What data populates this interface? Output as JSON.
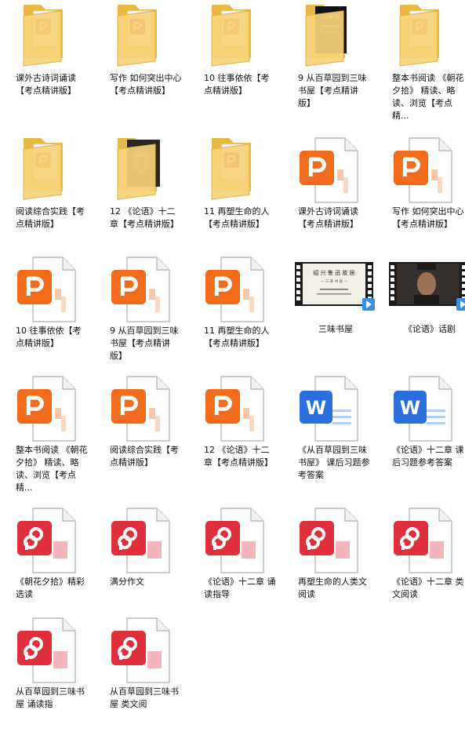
{
  "colors": {
    "folder_back": "#e8b943",
    "folder_front": "#f6d37a",
    "ppt_orange": "#f26a1b",
    "pdf_red": "#e02f3c",
    "word_blue": "#2a6fdb"
  },
  "items": [
    {
      "type": "folder",
      "thumb": "ppt",
      "label": "课外古诗词诵读【考点精讲版】"
    },
    {
      "type": "folder",
      "thumb": "ppt-red",
      "label": "写作 如何突出中心【考点精讲版】"
    },
    {
      "type": "folder",
      "thumb": "ppt",
      "label": "10 往事依依【考点精讲版】"
    },
    {
      "type": "folder",
      "thumb": "book",
      "label": "9 从百草园到三味书屋【考点精讲版】"
    },
    {
      "type": "folder",
      "thumb": "ppt",
      "label": "整本书阅读 《朝花夕拾》 精读、略读、浏览【考点精..."
    },
    {
      "type": "folder",
      "thumb": "ppt",
      "label": "阅读综合实践【考点精讲版】"
    },
    {
      "type": "folder",
      "thumb": "photo",
      "label": "12 《论语》十二章【考点精讲版】"
    },
    {
      "type": "folder",
      "thumb": "ppt-red",
      "label": "11 再塑生命的人【考点精讲版】"
    },
    {
      "type": "pptx",
      "label": "课外古诗词诵读【考点精讲版】"
    },
    {
      "type": "pptx",
      "label": "写作 如何突出中心【考点精讲版】"
    },
    {
      "type": "pptx",
      "label": "10 往事依依【考点精讲版】"
    },
    {
      "type": "pptx",
      "label": "9 从百草园到三味书屋【考点精讲版】"
    },
    {
      "type": "pptx",
      "label": "11 再塑生命的人【考点精讲版】"
    },
    {
      "type": "video",
      "thumb": "book",
      "label": "三味书屋"
    },
    {
      "type": "video",
      "thumb": "person",
      "label": "《论语》话剧"
    },
    {
      "type": "pptx",
      "label": "整本书阅读 《朝花夕拾》 精读、略读、浏览【考点精..."
    },
    {
      "type": "pptx",
      "label": "阅读综合实践【考点精讲版】"
    },
    {
      "type": "pptx",
      "label": "12 《论语》十二章【考点精讲版】"
    },
    {
      "type": "docx",
      "label": "《从百草园到三味书屋》 课后习题参考答案"
    },
    {
      "type": "docx",
      "label": "《论语》十二章 课后习题参考答案"
    },
    {
      "type": "pdf",
      "label": "《朝花夕拾》精彩选读"
    },
    {
      "type": "pdf",
      "label": "满分作文"
    },
    {
      "type": "pdf",
      "label": "《论语》十二章 诵读指导"
    },
    {
      "type": "pdf",
      "label": "再塑生命的人类文阅读"
    },
    {
      "type": "pdf",
      "label": "《论语》十二章 类文阅读"
    },
    {
      "type": "pdf",
      "label": "从百草园到三味书屋 诵读指"
    },
    {
      "type": "pdf",
      "label": "从百草园到三味书屋 类文阅"
    }
  ]
}
